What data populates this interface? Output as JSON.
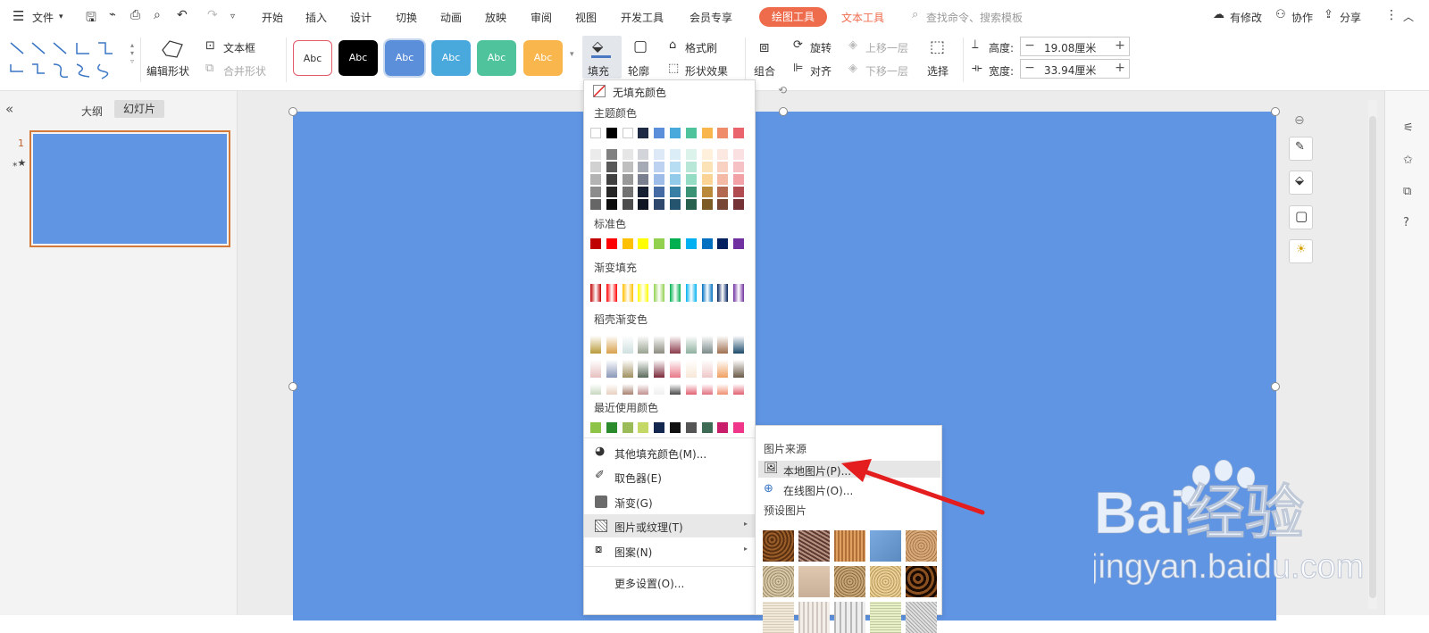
{
  "menu": {
    "file": "文件",
    "tabs": [
      "开始",
      "插入",
      "设计",
      "切换",
      "动画",
      "放映",
      "审阅",
      "视图",
      "开发工具",
      "会员专享"
    ],
    "drawing_tools": "绘图工具",
    "text_tools": "文本工具",
    "search_placeholder": "查找命令、搜索模板",
    "has_changes": "有修改",
    "collab": "协作",
    "share": "分享"
  },
  "ribbon": {
    "edit_shape": "编辑形状",
    "text_box": "文本框",
    "merge_shape": "合并形状",
    "styles": [
      "Abc",
      "Abc",
      "Abc",
      "Abc",
      "Abc",
      "Abc"
    ],
    "fill": "填充",
    "outline": "轮廓",
    "format_painter": "格式刷",
    "shape_effects": "形状效果",
    "group": "组合",
    "rotate": "旋转",
    "align": "对齐",
    "bring_forward": "上移一层",
    "send_backward": "下移一层",
    "select": "选择",
    "height_label": "高度:",
    "height_value": "19.08厘米",
    "width_label": "宽度:",
    "width_value": "33.94厘米"
  },
  "left_panel": {
    "outline_tab": "大纲",
    "slides_tab": "幻灯片",
    "slide_number": "1"
  },
  "fill_menu": {
    "no_fill": "无填充颜色",
    "theme_colors": "主题颜色",
    "standard_colors": "标准色",
    "gradient_fill": "渐变填充",
    "shell_gradient": "稻壳渐变色",
    "recent_colors": "最近使用颜色",
    "more_colors": "其他填充颜色(M)...",
    "eyedropper": "取色器(E)",
    "gradient": "渐变(G)",
    "picture_texture": "图片或纹理(T)",
    "pattern": "图案(N)",
    "more_settings": "更多设置(O)..."
  },
  "picture_menu": {
    "source_label": "图片来源",
    "local_picture": "本地图片(P)...",
    "online_picture": "在线图片(O)...",
    "preset_label": "预设图片"
  },
  "colors": {
    "accent": "#ee6b4c",
    "slide_fill": "#6095e4",
    "theme_top": [
      "#ffffff",
      "#000000",
      "#ffffff",
      "#1f2a44",
      "#5b8fd9",
      "#49a9dc",
      "#4fc49c",
      "#f8b64c",
      "#ef8c6a",
      "#e9646c"
    ],
    "standard": [
      "#c00000",
      "#ff0000",
      "#ffc000",
      "#ffff00",
      "#92d050",
      "#00b050",
      "#00b0f0",
      "#0070c0",
      "#002060",
      "#7030a0"
    ],
    "recent": [
      "#8dc447",
      "#2b8a2b",
      "#9bbb59",
      "#c4d867",
      "#14284f",
      "#111111",
      "#555555",
      "#3e6b55",
      "#c81e6b",
      "#f0368a"
    ]
  },
  "watermark": {
    "brand": "Bai经验",
    "url": "jingyan.baidu.com"
  }
}
